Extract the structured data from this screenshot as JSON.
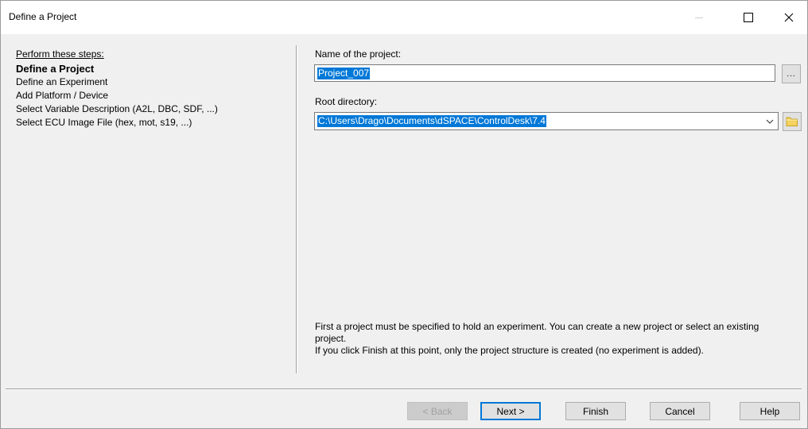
{
  "window": {
    "title": "Define a Project",
    "controls": {
      "minimize": "minimize",
      "maximize": "maximize",
      "close": "close"
    }
  },
  "steps": {
    "header": "Perform these steps:",
    "items": [
      {
        "label": "Define a Project",
        "active": true
      },
      {
        "label": "Define an Experiment",
        "active": false
      },
      {
        "label": "Add Platform / Device",
        "active": false
      },
      {
        "label": "Select Variable Description (A2L, DBC, SDF, ...)",
        "active": false
      },
      {
        "label": "Select ECU Image File (hex, mot, s19, ...)",
        "active": false
      }
    ]
  },
  "form": {
    "name_label": "Name of the project:",
    "name_value": "Project_007",
    "browse_label": "...",
    "root_label": "Root directory:",
    "root_value": "C:\\Users\\Drago\\Documents\\dSPACE\\ControlDesk\\7.4"
  },
  "info": {
    "line1": "First a project must be specified to hold an experiment. You can create a new project or select an existing project.",
    "line2": "If you click Finish at this point, only the project structure is created (no experiment is added)."
  },
  "buttons": {
    "back": "< Back",
    "next": "Next >",
    "finish": "Finish",
    "cancel": "Cancel",
    "help": "Help"
  },
  "colors": {
    "selection": "#0078d7",
    "dialog_bg": "#f0f0f0",
    "folder": "#f5d35e"
  }
}
